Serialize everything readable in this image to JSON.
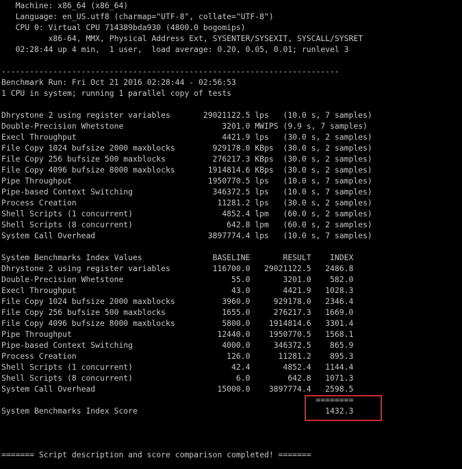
{
  "terminal": {
    "lines": [
      "   Machine: x86_64 (x86_64)",
      "   Language: en_US.utf8 (charmap=\"UTF-8\", collate=\"UTF-8\")",
      "   CPU 0: Virtual CPU 714389bda930 (4800.0 bogomips)",
      "          x86-64, MMX, Physical Address Ext, SYSENTER/SYSEXIT, SYSCALL/SYSRET",
      "   02:28:44 up 4 min,  1 user,  load average: 0.20, 0.05, 0.01; runlevel 3",
      "",
      "------------------------------------------------------------------------",
      "Benchmark Run: Fri Oct 21 2016 02:28:44 - 02:56:53",
      "1 CPU in system; running 1 parallel copy of tests",
      "",
      "Dhrystone 2 using register variables       29021122.5 lps   (10.0 s, 7 samples)",
      "Double-Precision Whetstone                     3201.0 MWIPS (9.9 s, 7 samples)",
      "Execl Throughput                               4421.9 lps   (30.0 s, 2 samples)",
      "File Copy 1024 bufsize 2000 maxblocks        929178.0 KBps  (30.0 s, 2 samples)",
      "File Copy 256 bufsize 500 maxblocks          276217.3 KBps  (30.0 s, 2 samples)",
      "File Copy 4096 bufsize 8000 maxblocks       1914814.6 KBps  (30.0 s, 2 samples)",
      "Pipe Throughput                             1950770.5 lps   (10.0 s, 7 samples)",
      "Pipe-based Context Switching                 346372.5 lps   (10.0 s, 7 samples)",
      "Process Creation                              11281.2 lps   (30.0 s, 2 samples)",
      "Shell Scripts (1 concurrent)                   4852.4 lpm   (60.0 s, 2 samples)",
      "Shell Scripts (8 concurrent)                    642.8 lpm   (60.0 s, 2 samples)",
      "System Call Overhead                        3897774.4 lps   (10.0 s, 7 samples)",
      "",
      "System Benchmarks Index Values               BASELINE       RESULT    INDEX",
      "Dhrystone 2 using register variables         116700.0   29021122.5   2486.8",
      "Double-Precision Whetstone                       55.0       3201.0    582.0",
      "Execl Throughput                                 43.0       4421.9   1028.3",
      "File Copy 1024 bufsize 2000 maxblocks          3960.0     929178.0   2346.4",
      "File Copy 256 bufsize 500 maxblocks            1655.0     276217.3   1669.0",
      "File Copy 4096 bufsize 8000 maxblocks          5800.0    1914814.6   3301.4",
      "Pipe Throughput                               12440.0    1950770.5   1568.1",
      "Pipe-based Context Switching                   4000.0     346372.5    865.9",
      "Process Creation                                126.0      11281.2    895.3",
      "Shell Scripts (1 concurrent)                     42.4       4852.4   1144.4",
      "Shell Scripts (8 concurrent)                      6.0        642.8   1071.3",
      "System Call Overhead                          15000.0    3897774.4   2598.5",
      "                                                                   ========",
      "System Benchmarks Index Score                                        1432.3",
      "",
      "",
      "",
      "======= Script description and score comparison completed! ======="
    ]
  },
  "colors": {
    "background": "#000000",
    "text": "#c8c8c8",
    "highlight": "#d9262b"
  }
}
